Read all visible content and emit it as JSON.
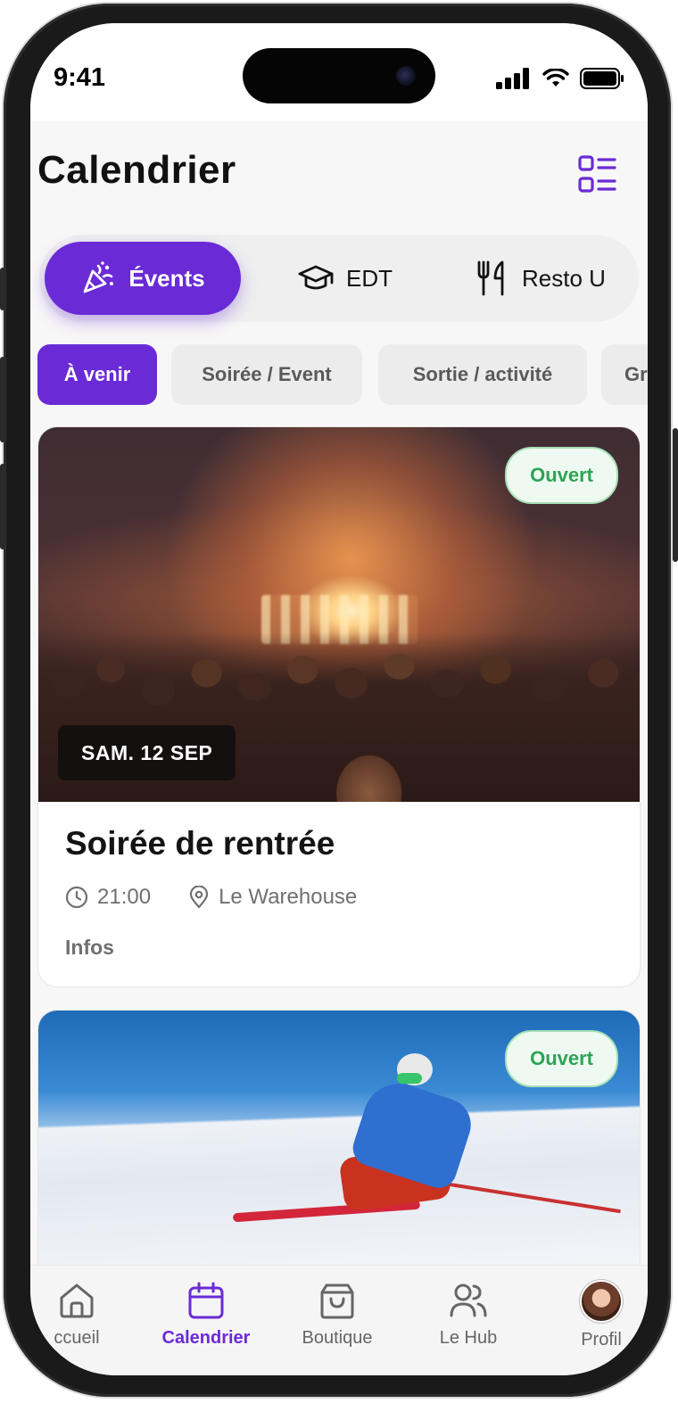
{
  "status_bar": {
    "time": "9:41"
  },
  "header": {
    "title": "Calendrier"
  },
  "segments": [
    {
      "label": "Évents",
      "icon": "party-popper-icon",
      "active": true
    },
    {
      "label": "EDT",
      "icon": "graduation-cap-icon",
      "active": false
    },
    {
      "label": "Resto U",
      "icon": "fork-knife-icon",
      "active": false
    }
  ],
  "filters": [
    {
      "label": "À venir",
      "active": true
    },
    {
      "label": "Soirée / Event",
      "active": false
    },
    {
      "label": "Sortie / activité",
      "active": false
    },
    {
      "label": "Gr",
      "active": false
    }
  ],
  "events": [
    {
      "title": "Soirée de rentrée",
      "date": "SAM. 12 SEP",
      "time": "21:00",
      "location": "Le Warehouse",
      "status": "Ouvert",
      "infos_label": "Infos",
      "image": "concert-crowd"
    },
    {
      "status": "Ouvert",
      "image": "skier-on-slope"
    }
  ],
  "tab_bar": [
    {
      "label": "ccueil",
      "icon": "home-icon",
      "active": false
    },
    {
      "label": "Calendrier",
      "icon": "calendar-icon",
      "active": true
    },
    {
      "label": "Boutique",
      "icon": "shopping-bag-icon",
      "active": false
    },
    {
      "label": "Le Hub",
      "icon": "users-icon",
      "active": false
    },
    {
      "label": "Profil",
      "icon": "avatar",
      "active": false
    }
  ],
  "colors": {
    "accent": "#6a2bd6",
    "status_open_text": "#2ea355",
    "status_open_bg": "#eefaf1",
    "background": "#f8f7f7"
  }
}
